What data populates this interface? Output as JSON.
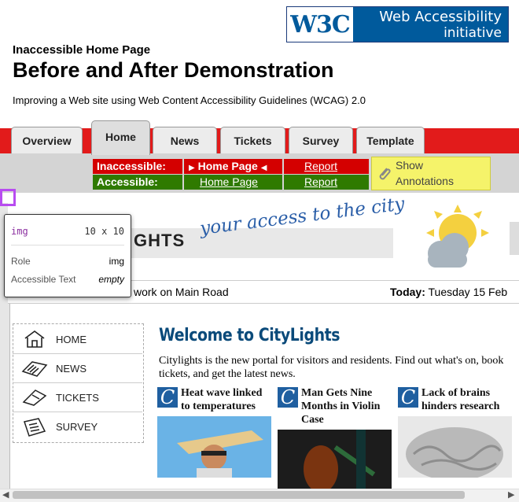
{
  "logo": {
    "mark": "W3C",
    "line1": "Web Accessibility",
    "line2": "initiative"
  },
  "header": {
    "kicker": "Inaccessible Home Page",
    "title": "Before and After Demonstration",
    "subtitle": "Improving a Web site using Web Content Accessibility Guidelines (WCAG) 2.0"
  },
  "tabs": [
    "Overview",
    "Home",
    "News",
    "Tickets",
    "Survey",
    "Template"
  ],
  "status": {
    "inaccessible_label": "Inaccessible:",
    "inaccessible_page": "Home Page",
    "inaccessible_report": "Report",
    "accessible_label": "Accessible:",
    "accessible_page": "Home Page",
    "accessible_report": "Report",
    "annotations_line1": "Show",
    "annotations_line2": "Annotations"
  },
  "banner": {
    "logo_fragment": "GHTS",
    "tagline": "your access to the city"
  },
  "ticker": {
    "headline_fragment": "work on Main Road",
    "today_label": "Today:",
    "today_value": "Tuesday 15 Feb"
  },
  "menu": [
    "HOME",
    "NEWS",
    "TICKETS",
    "SURVEY"
  ],
  "main": {
    "welcome": "Welcome to CityLights",
    "intro": "Citylights is the new portal for visitors and residents. Find out what's on, book tickets, and get the latest news.",
    "cards": [
      {
        "icon": "C",
        "headline": "Heat wave linked to temperatures"
      },
      {
        "icon": "C",
        "headline": "Man Gets Nine Months in Violin Case"
      },
      {
        "icon": "C",
        "headline": "Lack of brains hinders research"
      }
    ]
  },
  "tooltip": {
    "element": "img",
    "size": "10 x 10",
    "role_label": "Role",
    "role_value": "img",
    "text_label": "Accessible Text",
    "text_value": "empty"
  },
  "colors": {
    "accent_red": "#e21b1b",
    "status_red": "#d40000",
    "status_green": "#2f7a00",
    "annotation_yellow": "#f5f36a",
    "w3c_blue": "#005a9c",
    "heading_blue": "#0a4a7a",
    "selection_purple": "#b84cf0"
  }
}
